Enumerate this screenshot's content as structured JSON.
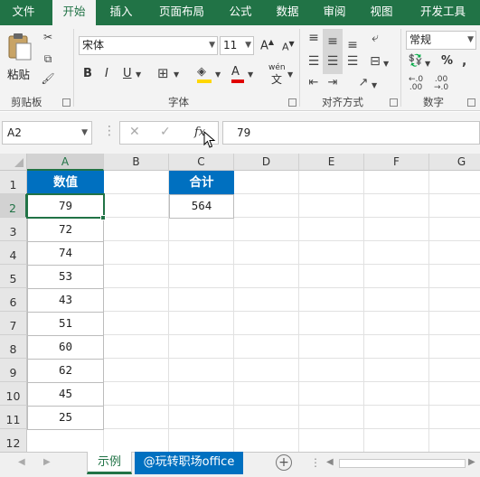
{
  "tabs": [
    {
      "label": "文件",
      "active": false
    },
    {
      "label": "开始",
      "active": true
    },
    {
      "label": "插入",
      "active": false
    },
    {
      "label": "页面布局",
      "active": false
    },
    {
      "label": "公式",
      "active": false
    },
    {
      "label": "数据",
      "active": false
    },
    {
      "label": "审阅",
      "active": false
    },
    {
      "label": "视图",
      "active": false
    },
    {
      "label": "开发工具",
      "active": false
    }
  ],
  "ribbon": {
    "clipboard": {
      "paste_label": "粘贴",
      "group_label": "剪贴板"
    },
    "font": {
      "font_name": "宋体",
      "font_size": "11",
      "bold": "B",
      "italic": "I",
      "underline": "U",
      "group_label": "字体",
      "wen_label": "wén"
    },
    "alignment": {
      "group_label": "对齐方式"
    },
    "number": {
      "format": "常规",
      "percent": "%",
      "group_label": "数字"
    }
  },
  "formula_bar": {
    "name_box": "A2",
    "fx": "fx",
    "value": "79"
  },
  "columns": [
    "A",
    "B",
    "C",
    "D",
    "E",
    "F",
    "G"
  ],
  "rows": [
    "1",
    "2",
    "3",
    "4",
    "5",
    "6",
    "7",
    "8",
    "9",
    "10",
    "11",
    "12"
  ],
  "cells": {
    "a_header": "数值",
    "a_values": [
      "79",
      "72",
      "74",
      "53",
      "43",
      "51",
      "60",
      "62",
      "45",
      "25"
    ],
    "c_header": "合计",
    "c_value": "564"
  },
  "sheets": [
    {
      "label": "示例",
      "active": true
    },
    {
      "label": "@玩转职场office",
      "active": false
    }
  ],
  "colors": {
    "brand": "#217346",
    "header_fill": "#0070c0"
  }
}
